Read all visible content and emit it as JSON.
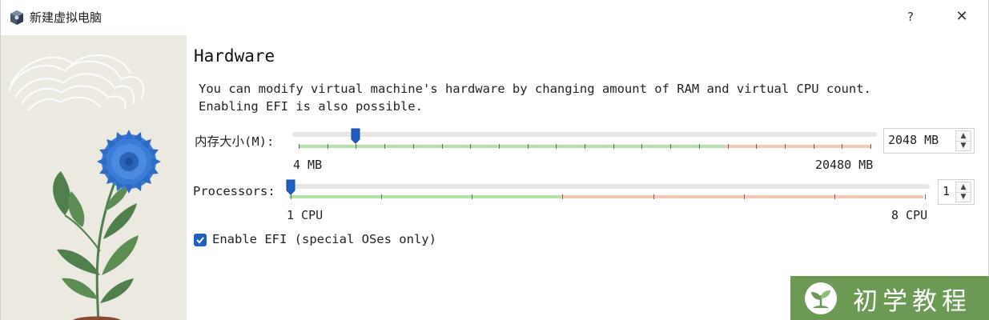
{
  "window": {
    "title": "新建虚拟电脑",
    "help_label": "?",
    "close_label": "✕"
  },
  "page": {
    "heading": "Hardware",
    "description": "You can modify virtual machine's hardware by changing amount of RAM and virtual CPU count.\nEnabling EFI is also possible."
  },
  "memory": {
    "label": "内存大小(M):",
    "value": "2048 MB",
    "min_label": "4 MB",
    "max_label": "20480 MB",
    "min_mb": 4,
    "max_mb": 20480,
    "current_mb": 2048
  },
  "processors": {
    "label": "Processors:",
    "value": "1",
    "min_label": "1 CPU",
    "max_label": "8 CPU",
    "min": 1,
    "max": 8,
    "current": 1
  },
  "efi": {
    "label": "Enable EFI (special OSes only)",
    "checked": true
  },
  "watermark": {
    "text": "初学教程"
  },
  "colors": {
    "accent": "#1f5fbf",
    "recommended_range": "#b3e2a8",
    "not_recommended_range": "#f3c7b4",
    "watermark_bg": "#6a9a54"
  }
}
